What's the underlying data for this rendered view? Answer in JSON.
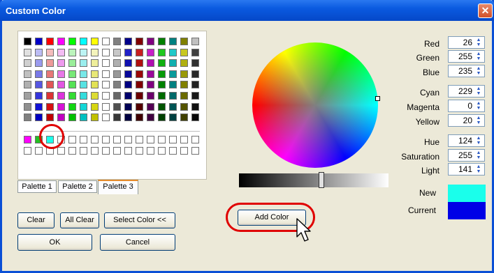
{
  "window": {
    "title": "Custom Color"
  },
  "palette": {
    "rows": [
      [
        "#000000",
        "#0000c8",
        "#ff0000",
        "#ff00ff",
        "#00ff00",
        "#00ffff",
        "#ffff00",
        "#ffffff",
        "#808080",
        "#00008b",
        "#800000",
        "#800080",
        "#008000",
        "#008080",
        "#808000",
        "#c0c0c0"
      ],
      [
        "#e0e0e0",
        "#bcbcf4",
        "#f4bcbc",
        "#f4bcf4",
        "#bcf4bc",
        "#bcf4f4",
        "#f4f4bc",
        "#ffffff",
        "#c8c8c8",
        "#2020c8",
        "#c82020",
        "#c820c8",
        "#20c820",
        "#20c8c8",
        "#c8c820",
        "#404040"
      ],
      [
        "#d0d0d0",
        "#9a9aee",
        "#ee9a9a",
        "#ee9aee",
        "#9aee9a",
        "#9aeeee",
        "#eeee9a",
        "#ffffff",
        "#b0b0b0",
        "#1010b0",
        "#b01010",
        "#b010b0",
        "#10b010",
        "#10b0b0",
        "#b0b010",
        "#303030"
      ],
      [
        "#c0c0c0",
        "#7878e8",
        "#e87878",
        "#e878e8",
        "#78e878",
        "#78e8e8",
        "#e8e878",
        "#ffffff",
        "#989898",
        "#08089a",
        "#9a0808",
        "#9a089a",
        "#089a08",
        "#089a9a",
        "#9a9a08",
        "#282828"
      ],
      [
        "#b0b0b0",
        "#5656e2",
        "#e25656",
        "#e256e2",
        "#56e256",
        "#56e2e2",
        "#e2e256",
        "#ffffff",
        "#808080",
        "#000080",
        "#800000",
        "#800080",
        "#008000",
        "#008080",
        "#808000",
        "#202020"
      ],
      [
        "#a0a0a0",
        "#3434dc",
        "#dc3434",
        "#dc34dc",
        "#34dc34",
        "#34dcdc",
        "#dcdc34",
        "#ffffff",
        "#686868",
        "#00006a",
        "#6a0000",
        "#6a006a",
        "#006a00",
        "#006a6a",
        "#6a6a00",
        "#181818"
      ],
      [
        "#909090",
        "#1212d6",
        "#d61212",
        "#d612d6",
        "#12d612",
        "#12d6d6",
        "#d6d612",
        "#ffffff",
        "#505050",
        "#000054",
        "#540000",
        "#540054",
        "#005400",
        "#005454",
        "#545400",
        "#101010"
      ],
      [
        "#808080",
        "#0000c0",
        "#c00000",
        "#c000c0",
        "#00c000",
        "#00c0c0",
        "#c0c000",
        "#ffffff",
        "#383838",
        "#000040",
        "#400000",
        "#400040",
        "#004000",
        "#004040",
        "#404000",
        "#080808"
      ]
    ],
    "custom_rows": [
      [
        "#ff00ff",
        "#22c022",
        "#1affeb",
        "#ffffff",
        "#ffffff",
        "#ffffff",
        "#ffffff",
        "#ffffff",
        "#ffffff",
        "#ffffff",
        "#ffffff",
        "#ffffff",
        "#ffffff",
        "#ffffff",
        "#ffffff",
        "#ffffff"
      ],
      [
        "#ffffff",
        "#ffffff",
        "#ffffff",
        "#ffffff",
        "#ffffff",
        "#ffffff",
        "#ffffff",
        "#ffffff",
        "#ffffff",
        "#ffffff",
        "#ffffff",
        "#ffffff",
        "#ffffff",
        "#ffffff",
        "#ffffff",
        "#ffffff"
      ]
    ]
  },
  "tabs": [
    {
      "label": "Palette 1",
      "active": false
    },
    {
      "label": "Palette 2",
      "active": false
    },
    {
      "label": "Palette 3",
      "active": true
    }
  ],
  "buttons": {
    "clear": "Clear",
    "all_clear": "All Clear",
    "select_color": "Select Color <<",
    "ok": "OK",
    "cancel": "Cancel",
    "add_color": "Add Color"
  },
  "fields": {
    "red": {
      "label": "Red",
      "value": "26"
    },
    "green": {
      "label": "Green",
      "value": "255"
    },
    "blue": {
      "label": "Blue",
      "value": "235"
    },
    "cyan": {
      "label": "Cyan",
      "value": "229"
    },
    "magenta": {
      "label": "Magenta",
      "value": "0"
    },
    "yellow": {
      "label": "Yellow",
      "value": "20"
    },
    "hue": {
      "label": "Hue",
      "value": "124"
    },
    "saturation": {
      "label": "Saturation",
      "value": "255"
    },
    "light": {
      "label": "Light",
      "value": "141"
    }
  },
  "preview": {
    "new_label": "New",
    "current_label": "Current",
    "new_color": "#1affeb",
    "current_color": "#0000e6"
  },
  "colors": {
    "title_bar": "#0a5ae0",
    "highlight_ring": "#e00000"
  }
}
